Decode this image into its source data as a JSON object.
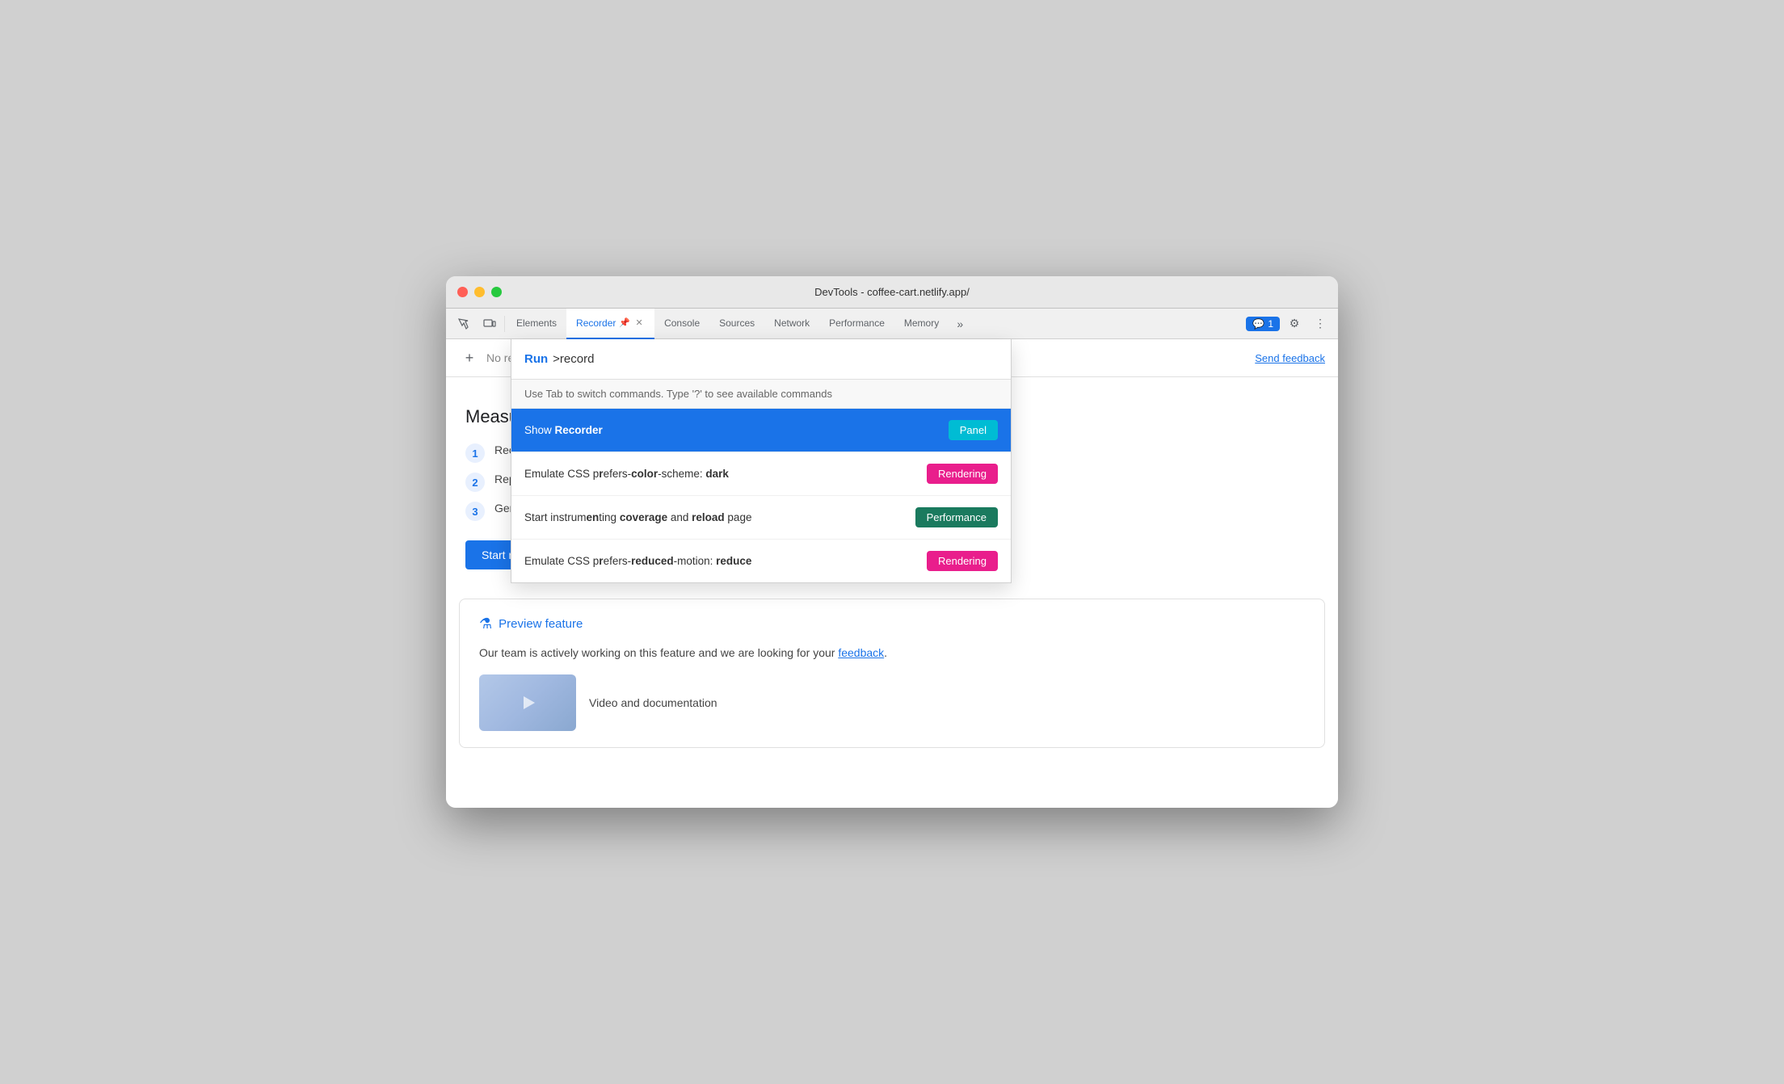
{
  "window": {
    "title": "DevTools - coffee-cart.netlify.app/"
  },
  "tabs": [
    {
      "id": "elements",
      "label": "Elements",
      "active": false,
      "closable": false
    },
    {
      "id": "recorder",
      "label": "Recorder",
      "active": true,
      "closable": true
    },
    {
      "id": "console",
      "label": "Console",
      "active": false,
      "closable": false
    },
    {
      "id": "sources",
      "label": "Sources",
      "active": false,
      "closable": false
    },
    {
      "id": "network",
      "label": "Network",
      "active": false,
      "closable": false
    },
    {
      "id": "performance",
      "label": "Performance",
      "active": false,
      "closable": false
    },
    {
      "id": "memory",
      "label": "Memory",
      "active": false,
      "closable": false
    }
  ],
  "toolbar": {
    "more_tabs_label": "»",
    "feedback_count": "1",
    "settings_icon": "⚙",
    "more_icon": "⋮"
  },
  "recorder": {
    "add_button": "+",
    "no_recordings": "No recordings",
    "send_feedback": "Send feedback",
    "measure_title": "Measure perfo",
    "steps": [
      {
        "num": "1",
        "text": "Record a comr"
      },
      {
        "num": "2",
        "text": "Replay the rec"
      },
      {
        "num": "3",
        "text": "Generate a det"
      }
    ],
    "start_recording_btn": "Start new recording"
  },
  "preview": {
    "icon": "⚗",
    "title": "Preview feature",
    "description": "Our team is actively working on this feature and we are looking for your",
    "feedback_link": "feedback",
    "description_end": ".",
    "video_title": "Video and documentation"
  },
  "command_palette": {
    "run_label": "Run",
    "command_text": ">record",
    "hint": "Use Tab to switch commands. Type '?' to see available commands",
    "items": [
      {
        "id": "show-recorder",
        "text_prefix": "Show ",
        "text_bold": "Recorder",
        "badge": "Panel",
        "badge_class": "badge-panel",
        "highlighted": true
      },
      {
        "id": "emulate-dark",
        "text_prefix": "Emulate CSS p",
        "text_bold_parts": [
          "r",
          "efers-",
          "color",
          "-scheme: ",
          "dark"
        ],
        "text_raw": "Emulate CSS prefers-color-scheme: dark",
        "badge": "Rendering",
        "badge_class": "badge-rendering",
        "highlighted": false
      },
      {
        "id": "coverage",
        "text_raw": "Start instrumenting coverage and reload page",
        "badge": "Performance",
        "badge_class": "badge-performance",
        "highlighted": false
      },
      {
        "id": "emulate-motion",
        "text_raw": "Emulate CSS prefers-reduced-motion: reduce",
        "badge": "Rendering",
        "badge_class": "badge-rendering",
        "highlighted": false
      }
    ]
  }
}
